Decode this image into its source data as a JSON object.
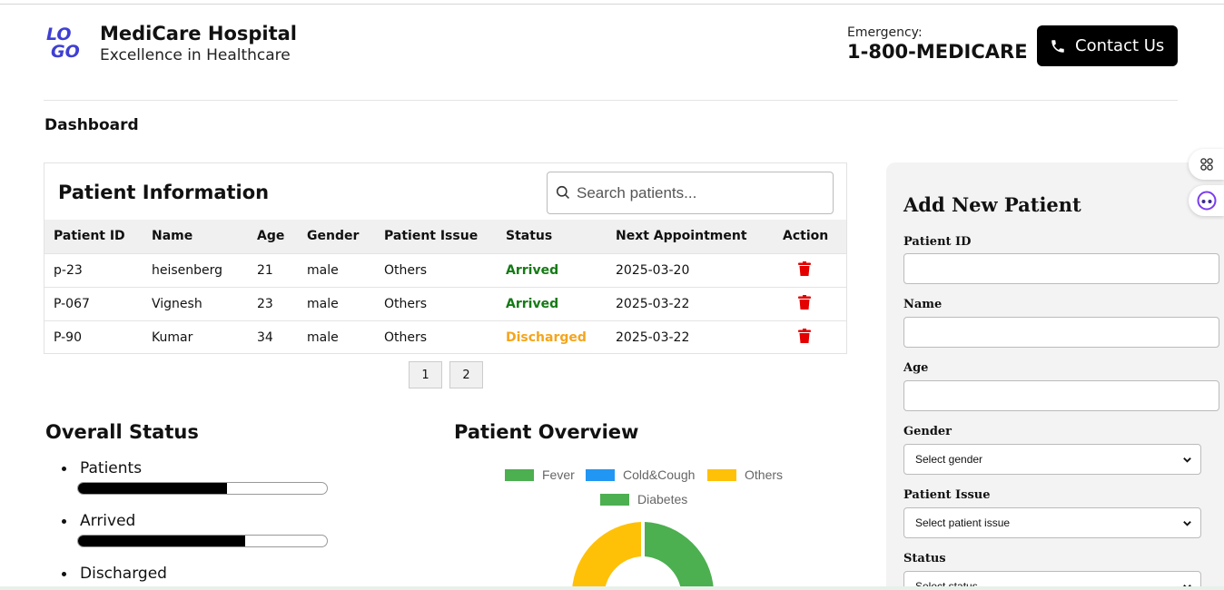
{
  "header": {
    "logo_top": "LO",
    "logo_bottom": "GO",
    "title": "MediCare Hospital",
    "subtitle": "Excellence in Healthcare",
    "emergency_label": "Emergency:",
    "emergency_number": "1-800-MEDICARE",
    "contact_label": "Contact Us"
  },
  "page_title": "Dashboard",
  "patients": {
    "title": "Patient Information",
    "search_placeholder": "Search patients...",
    "columns": [
      "Patient ID",
      "Name",
      "Age",
      "Gender",
      "Patient Issue",
      "Status",
      "Next Appointment",
      "Action"
    ],
    "rows": [
      {
        "id": "p-23",
        "name": "heisenberg",
        "age": "21",
        "gender": "male",
        "issue": "Others",
        "status": "Arrived",
        "appointment": "2025-03-20"
      },
      {
        "id": "P-067",
        "name": "Vignesh",
        "age": "23",
        "gender": "male",
        "issue": "Others",
        "status": "Arrived",
        "appointment": "2025-03-22"
      },
      {
        "id": "P-90",
        "name": "Kumar",
        "age": "34",
        "gender": "male",
        "issue": "Others",
        "status": "Discharged",
        "appointment": "2025-03-22"
      }
    ],
    "pages": [
      "1",
      "2"
    ]
  },
  "overall_status": {
    "title": "Overall Status",
    "items": [
      {
        "label": "Patients",
        "fraction": 0.6
      },
      {
        "label": "Arrived",
        "fraction": 0.67
      },
      {
        "label": "Discharged",
        "fraction": null
      }
    ]
  },
  "patient_overview": {
    "title": "Patient Overview"
  },
  "chart_data": {
    "type": "pie",
    "categories": [
      "Fever",
      "Cold&Cough",
      "Others",
      "Diabetes"
    ],
    "colors": [
      "#4caf50",
      "#2196f3",
      "#ffc107",
      "#4caf50"
    ],
    "legend_position": "top"
  },
  "form": {
    "title": "Add New Patient",
    "fields": {
      "patient_id": "Patient ID",
      "name": "Name",
      "age": "Age",
      "gender": "Gender",
      "gender_placeholder": "Select gender",
      "issue": "Patient Issue",
      "issue_placeholder": "Select patient issue",
      "status": "Status",
      "status_placeholder": "Select status"
    }
  },
  "colors": {
    "accent": "#3f3fd4",
    "arrived": "#147a14",
    "discharged": "#f5a51c",
    "delete": "#e50000"
  },
  "icons": [
    "search-icon",
    "phone-icon",
    "trash-icon",
    "chevron-down-icon",
    "apps-icon",
    "assistant-icon"
  ]
}
